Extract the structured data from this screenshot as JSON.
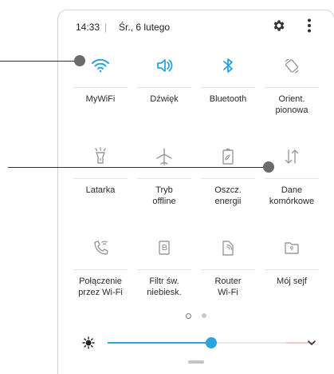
{
  "header": {
    "time": "14:33",
    "separator": "|",
    "date": "Śr., 6 lutego",
    "icons": [
      "gear-icon",
      "more-vertical-icon"
    ]
  },
  "tiles": [
    {
      "label": "MyWiFi",
      "icon": "wifi-icon",
      "active": true
    },
    {
      "label": "Dźwięk",
      "icon": "sound-icon",
      "active": true
    },
    {
      "label": "Bluetooth",
      "icon": "bluetooth-icon",
      "active": true
    },
    {
      "label": "Orient.\npionowa",
      "icon": "rotation-icon",
      "active": false
    },
    {
      "label": "Latarka",
      "icon": "flashlight-icon",
      "active": false
    },
    {
      "label": "Tryb\noffline",
      "icon": "airplane-icon",
      "active": false
    },
    {
      "label": "Oszcz.\nenergii",
      "icon": "battery-saver-icon",
      "active": false
    },
    {
      "label": "Dane\nkomórkowe",
      "icon": "mobile-data-icon",
      "active": false
    },
    {
      "label": "Połączenie\nprzez Wi-Fi",
      "icon": "wifi-calling-icon",
      "active": false
    },
    {
      "label": "Filtr św.\nniebiesk.",
      "icon": "blue-light-filter-icon",
      "active": false
    },
    {
      "label": "Router\nWi-Fi",
      "icon": "hotspot-icon",
      "active": false
    },
    {
      "label": "Mój sejf",
      "icon": "secure-folder-icon",
      "active": false
    }
  ],
  "pagination": {
    "pages": 2,
    "current": 1
  },
  "brightness": {
    "level": 0.5,
    "icon": "brightness-icon",
    "expand_icon": "chevron-down-icon"
  },
  "colors": {
    "accent": "#2aa4de",
    "inactive_icon": "#9a9a9a",
    "text": "#2b2b2b"
  }
}
